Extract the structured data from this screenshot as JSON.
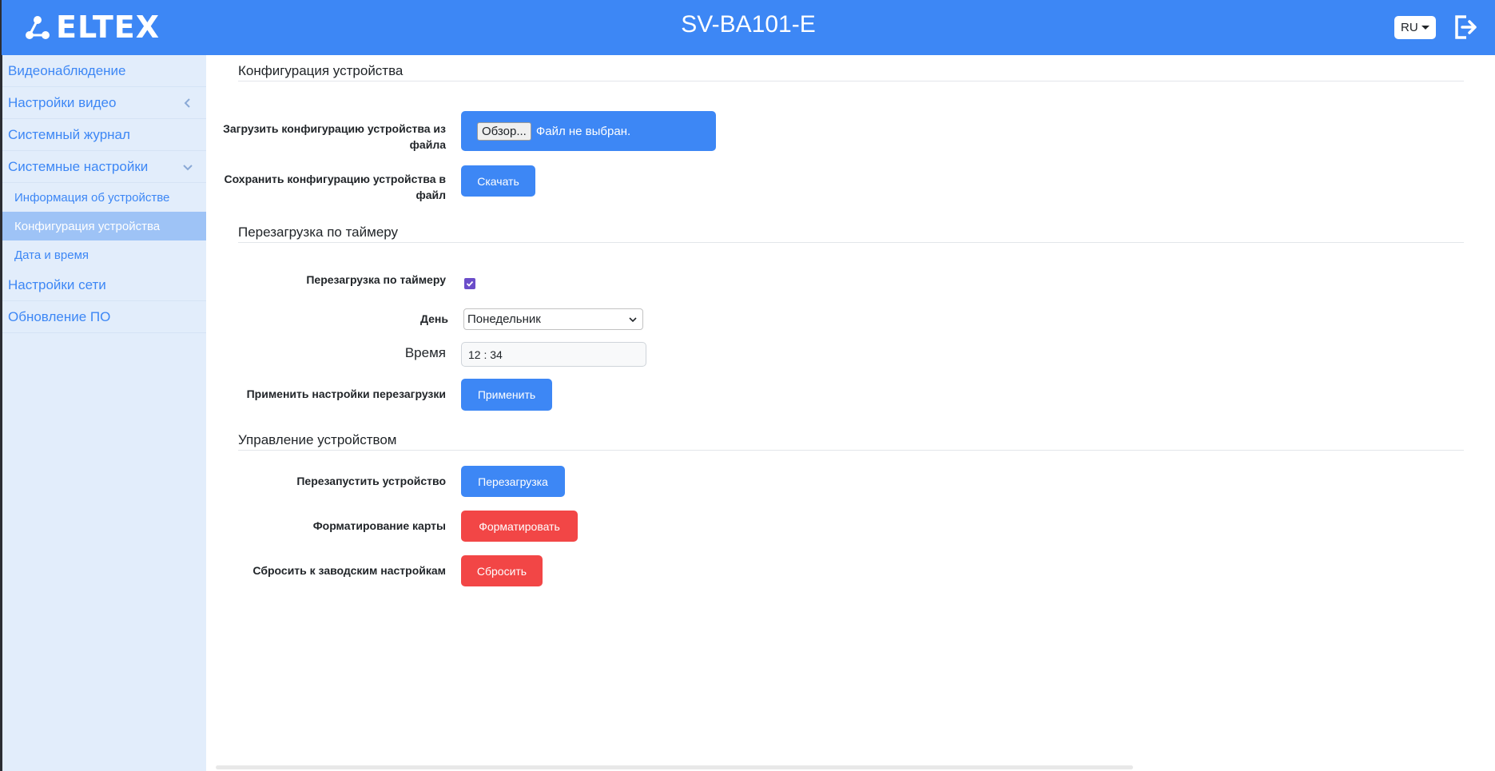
{
  "header": {
    "logo_text": "ELTEX",
    "device_name": "SV-BA101-E",
    "language": "RU"
  },
  "sidebar": {
    "items": [
      {
        "label": "Видеонаблюдение"
      },
      {
        "label": "Настройки видео"
      },
      {
        "label": "Системный журнал"
      },
      {
        "label": "Системные настройки"
      },
      {
        "label": "Настройки сети"
      },
      {
        "label": "Обновление ПО"
      }
    ],
    "sub_items": [
      {
        "label": "Информация об устройстве"
      },
      {
        "label": "Конфигурация устройства"
      },
      {
        "label": "Дата и время"
      }
    ]
  },
  "config": {
    "title": "Конфигурация устройства",
    "upload_label_line1": "Загрузить конфигурацию устройства из",
    "upload_label_line2": "файла",
    "browse_label": "Обзор...",
    "no_file_text": "Файл не выбран.",
    "save_label_line1": "Сохранить конфигурацию устройства в",
    "save_label_line2": "файл",
    "download_button": "Скачать"
  },
  "timer": {
    "title": "Перезагрузка по таймеру",
    "enable_label": "Перезагрузка по таймеру",
    "enabled": true,
    "day_label": "День",
    "day_value": "Понедельник",
    "time_label": "Время",
    "time_value": "12 : 34",
    "apply_label": "Применить настройки перезагрузки",
    "apply_button": "Применить"
  },
  "management": {
    "title": "Управление устройством",
    "reboot_label": "Перезапустить устройство",
    "reboot_button": "Перезагрузка",
    "format_label": "Форматирование карты",
    "format_button": "Форматировать",
    "reset_label": "Сбросить к заводским настройкам",
    "reset_button": "Сбросить"
  },
  "colors": {
    "primary": "#3d87f5",
    "danger": "#f24646",
    "sidebar_bg": "#e2edfb",
    "active_item_bg": "#9ec3f6"
  }
}
